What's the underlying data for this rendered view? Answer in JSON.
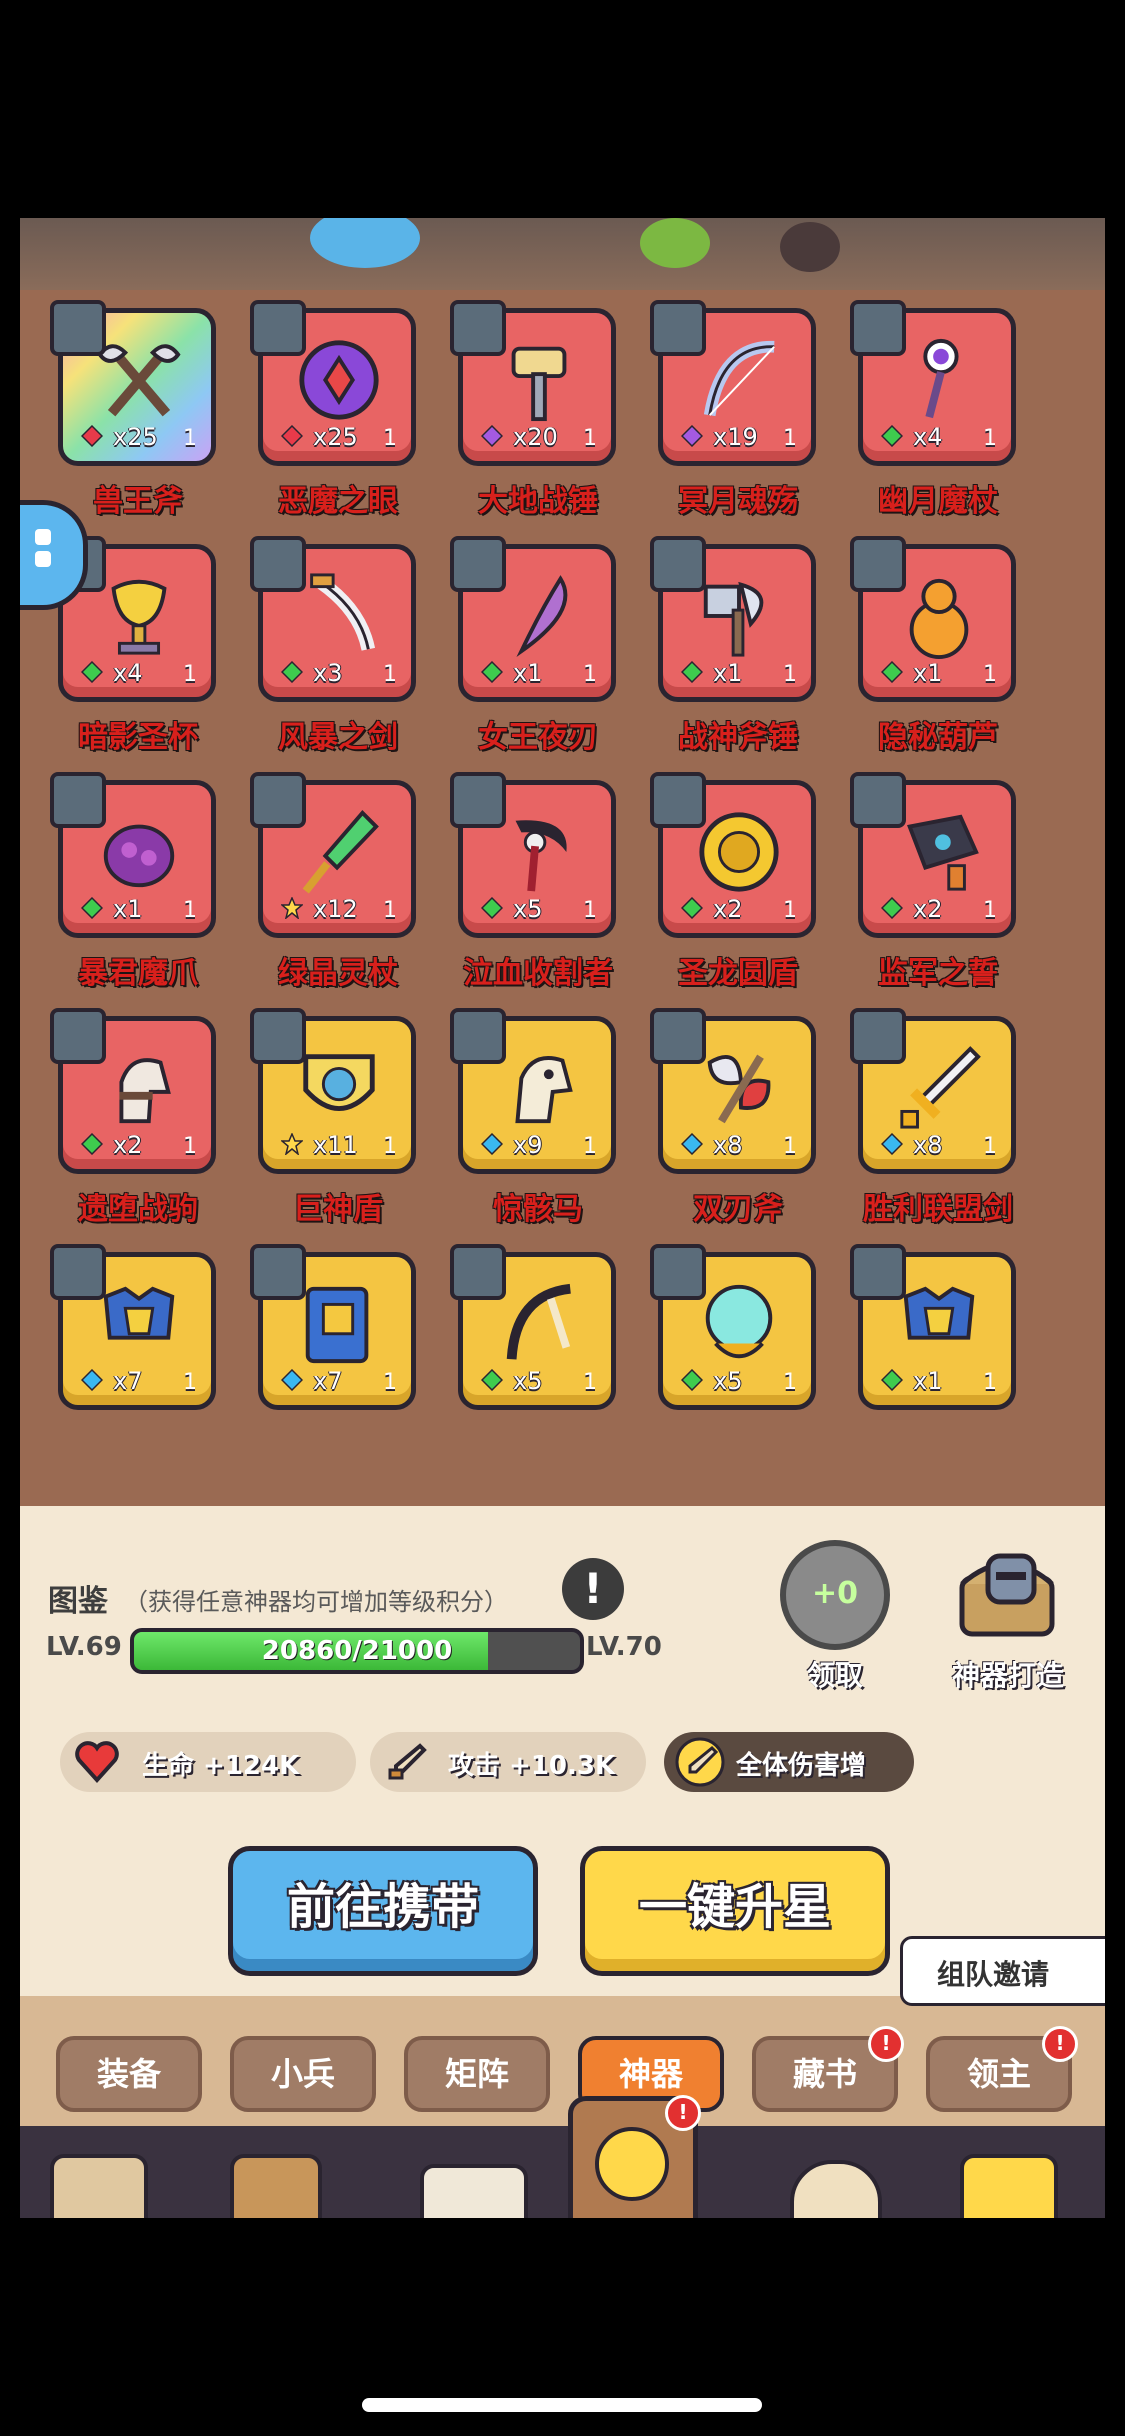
{
  "items": [
    {
      "name": "兽王斧",
      "count": "x25",
      "level": "1",
      "bg": "rainbow",
      "gem": "red",
      "art": "axes"
    },
    {
      "name": "恶魔之眼",
      "count": "x25",
      "level": "1",
      "bg": "red",
      "gem": "red",
      "art": "eye"
    },
    {
      "name": "大地战锤",
      "count": "x20",
      "level": "1",
      "bg": "red",
      "gem": "purple",
      "art": "hammer"
    },
    {
      "name": "冥月魂殇",
      "count": "x19",
      "level": "1",
      "bg": "red",
      "gem": "purple",
      "art": "bow"
    },
    {
      "name": "幽月魔杖",
      "count": "x4",
      "level": "1",
      "bg": "red",
      "gem": "green",
      "art": "staff"
    },
    {
      "name": "暗影圣杯",
      "count": "x4",
      "level": "1",
      "bg": "red",
      "gem": "green",
      "art": "grail"
    },
    {
      "name": "风暴之剑",
      "count": "x3",
      "level": "1",
      "bg": "red",
      "gem": "green",
      "art": "sword"
    },
    {
      "name": "女王夜刃",
      "count": "x1",
      "level": "1",
      "bg": "red",
      "gem": "green",
      "art": "blade"
    },
    {
      "name": "战神斧锤",
      "count": "x1",
      "level": "1",
      "bg": "red",
      "gem": "green",
      "art": "axehammer"
    },
    {
      "name": "隐秘葫芦",
      "count": "x1",
      "level": "1",
      "bg": "red",
      "gem": "green",
      "art": "gourd"
    },
    {
      "name": "暴君魔爪",
      "count": "x1",
      "level": "1",
      "bg": "red",
      "gem": "green",
      "art": "claw"
    },
    {
      "name": "绿晶灵杖",
      "count": "x12",
      "level": "1",
      "bg": "red",
      "gem": "star",
      "art": "crystal"
    },
    {
      "name": "泣血收割者",
      "count": "x5",
      "level": "1",
      "bg": "red",
      "gem": "green",
      "art": "scythe"
    },
    {
      "name": "圣龙圆盾",
      "count": "x2",
      "level": "1",
      "bg": "red",
      "gem": "green",
      "art": "roundshield"
    },
    {
      "name": "监军之誓",
      "count": "x2",
      "level": "1",
      "bg": "red",
      "gem": "green",
      "art": "gauntlet"
    },
    {
      "name": "遗堕战驹",
      "count": "x2",
      "level": "1",
      "bg": "red",
      "gem": "green",
      "art": "horse"
    },
    {
      "name": "巨神盾",
      "count": "x11",
      "level": "1",
      "bg": "gold",
      "gem": "star",
      "art": "shield"
    },
    {
      "name": "惊骸马",
      "count": "x9",
      "level": "1",
      "bg": "gold",
      "gem": "blue",
      "art": "skullhorse"
    },
    {
      "name": "双刃斧",
      "count": "x8",
      "level": "1",
      "bg": "gold",
      "gem": "blue",
      "art": "doubleaxe"
    },
    {
      "name": "胜利联盟剑",
      "count": "x8",
      "level": "1",
      "bg": "gold",
      "gem": "blue",
      "art": "goldsword"
    },
    {
      "name": "",
      "count": "x7",
      "level": "1",
      "bg": "gold",
      "gem": "blue",
      "art": "armor"
    },
    {
      "name": "",
      "count": "x7",
      "level": "1",
      "bg": "gold",
      "gem": "blue",
      "art": "book"
    },
    {
      "name": "",
      "count": "x5",
      "level": "1",
      "bg": "gold",
      "gem": "green",
      "art": "bow2"
    },
    {
      "name": "",
      "count": "x5",
      "level": "1",
      "bg": "gold",
      "gem": "green",
      "art": "orb"
    },
    {
      "name": "",
      "count": "x1",
      "level": "1",
      "bg": "gold",
      "gem": "green",
      "art": "armor"
    }
  ],
  "codex": {
    "title": "图鉴",
    "subtitle": "（获得任意神器均可增加等级积分）",
    "level_current": "LV.69",
    "level_next": "LV.70",
    "progress_text": "20860/21000",
    "progress_fraction": 0.9933
  },
  "claim": {
    "value": "+0",
    "label": "领取"
  },
  "forge": {
    "label": "神器打造"
  },
  "stats": [
    {
      "label": "生命 +124K",
      "icon": "heart-icon"
    },
    {
      "label": "攻击 +10.3K",
      "icon": "sword-icon"
    },
    {
      "label": "全体伤害增",
      "icon": "sword-icon"
    }
  ],
  "invite": {
    "label": "组队邀请"
  },
  "buttons": {
    "carry": "前往携带",
    "upgrade": "一键升星"
  },
  "tabs": [
    {
      "label": "装备",
      "active": false,
      "badge": false
    },
    {
      "label": "小兵",
      "active": false,
      "badge": false
    },
    {
      "label": "矩阵",
      "active": false,
      "badge": false
    },
    {
      "label": "神器",
      "active": true,
      "badge": false
    },
    {
      "label": "藏书",
      "active": false,
      "badge": true
    },
    {
      "label": "领主",
      "active": false,
      "badge": true
    }
  ],
  "colors": {
    "name_red": "#d8201c",
    "card_red": "#e86464",
    "card_gold": "#f4c542",
    "bg_brown": "#9a6a52",
    "active_tab": "#f08030"
  }
}
